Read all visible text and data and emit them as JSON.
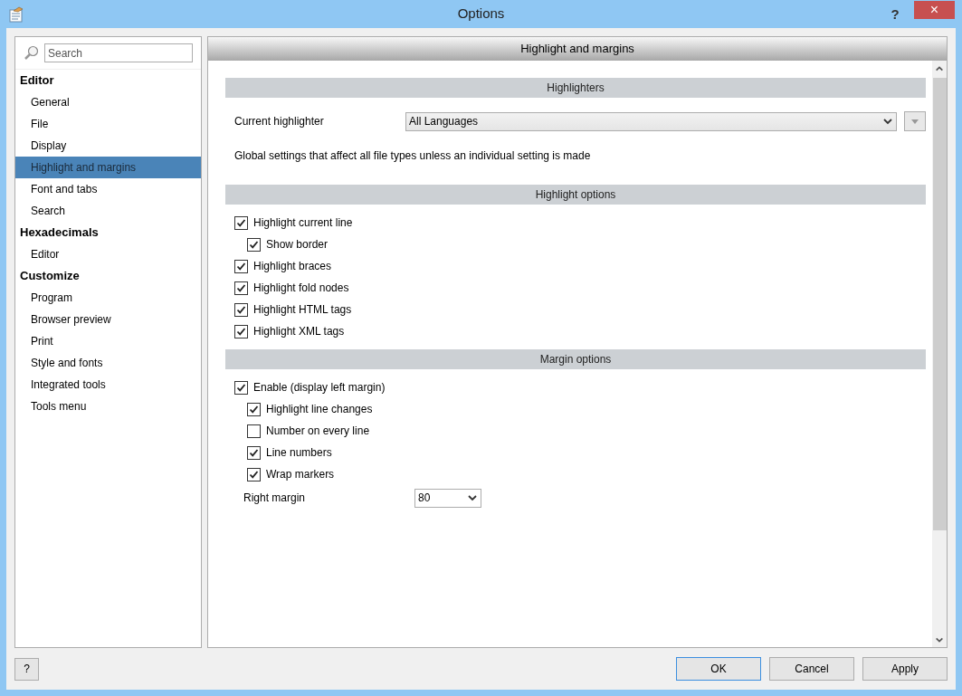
{
  "window": {
    "title": "Options",
    "help": "?",
    "close": "×"
  },
  "search": {
    "placeholder": "Search"
  },
  "sidebar": {
    "groups": [
      {
        "label": "Editor",
        "items": [
          {
            "label": "General",
            "selected": false
          },
          {
            "label": "File",
            "selected": false
          },
          {
            "label": "Display",
            "selected": false
          },
          {
            "label": "Highlight and margins",
            "selected": true
          },
          {
            "label": "Font and tabs",
            "selected": false
          },
          {
            "label": "Search",
            "selected": false
          }
        ]
      },
      {
        "label": "Hexadecimals",
        "items": [
          {
            "label": "Editor",
            "selected": false
          }
        ]
      },
      {
        "label": "Customize",
        "items": [
          {
            "label": "Program",
            "selected": false
          },
          {
            "label": "Browser preview",
            "selected": false
          },
          {
            "label": "Print",
            "selected": false
          },
          {
            "label": "Style and fonts",
            "selected": false
          },
          {
            "label": "Integrated tools",
            "selected": false
          },
          {
            "label": "Tools menu",
            "selected": false
          }
        ]
      }
    ]
  },
  "page": {
    "title": "Highlight and margins",
    "sections": [
      {
        "heading": "Highlighters",
        "rows": [
          {
            "kind": "combo",
            "label": "Current highlighter",
            "value": "All Languages"
          },
          {
            "kind": "note",
            "label": "Global settings that affect all file types unless an individual setting is made"
          }
        ]
      },
      {
        "heading": "Highlight options",
        "rows": [
          {
            "kind": "check",
            "label": "Highlight current line",
            "checked": true,
            "children": [
              {
                "kind": "check",
                "label": "Show border",
                "checked": true
              }
            ]
          },
          {
            "kind": "check",
            "label": "Highlight braces",
            "checked": true
          },
          {
            "kind": "check",
            "label": "Highlight fold nodes",
            "checked": true
          },
          {
            "kind": "check",
            "label": "Highlight HTML tags",
            "checked": true
          },
          {
            "kind": "check",
            "label": "Highlight XML tags",
            "checked": true
          }
        ]
      },
      {
        "heading": "Margin options",
        "rows": [
          {
            "kind": "check",
            "label": "Enable (display left margin)",
            "checked": true,
            "children": [
              {
                "kind": "check",
                "label": "Highlight line changes",
                "checked": true
              },
              {
                "kind": "check",
                "label": "Number on every line",
                "checked": false
              },
              {
                "kind": "check",
                "label": "Line numbers",
                "checked": true
              },
              {
                "kind": "check",
                "label": "Wrap markers",
                "checked": true
              },
              {
                "kind": "dropdown",
                "label": "Right margin",
                "value": "80"
              }
            ]
          }
        ]
      }
    ]
  },
  "buttons": {
    "help": "?",
    "actions": [
      {
        "label": "OK",
        "default": true
      },
      {
        "label": "Cancel",
        "default": false
      },
      {
        "label": "Apply",
        "default": false
      }
    ]
  }
}
